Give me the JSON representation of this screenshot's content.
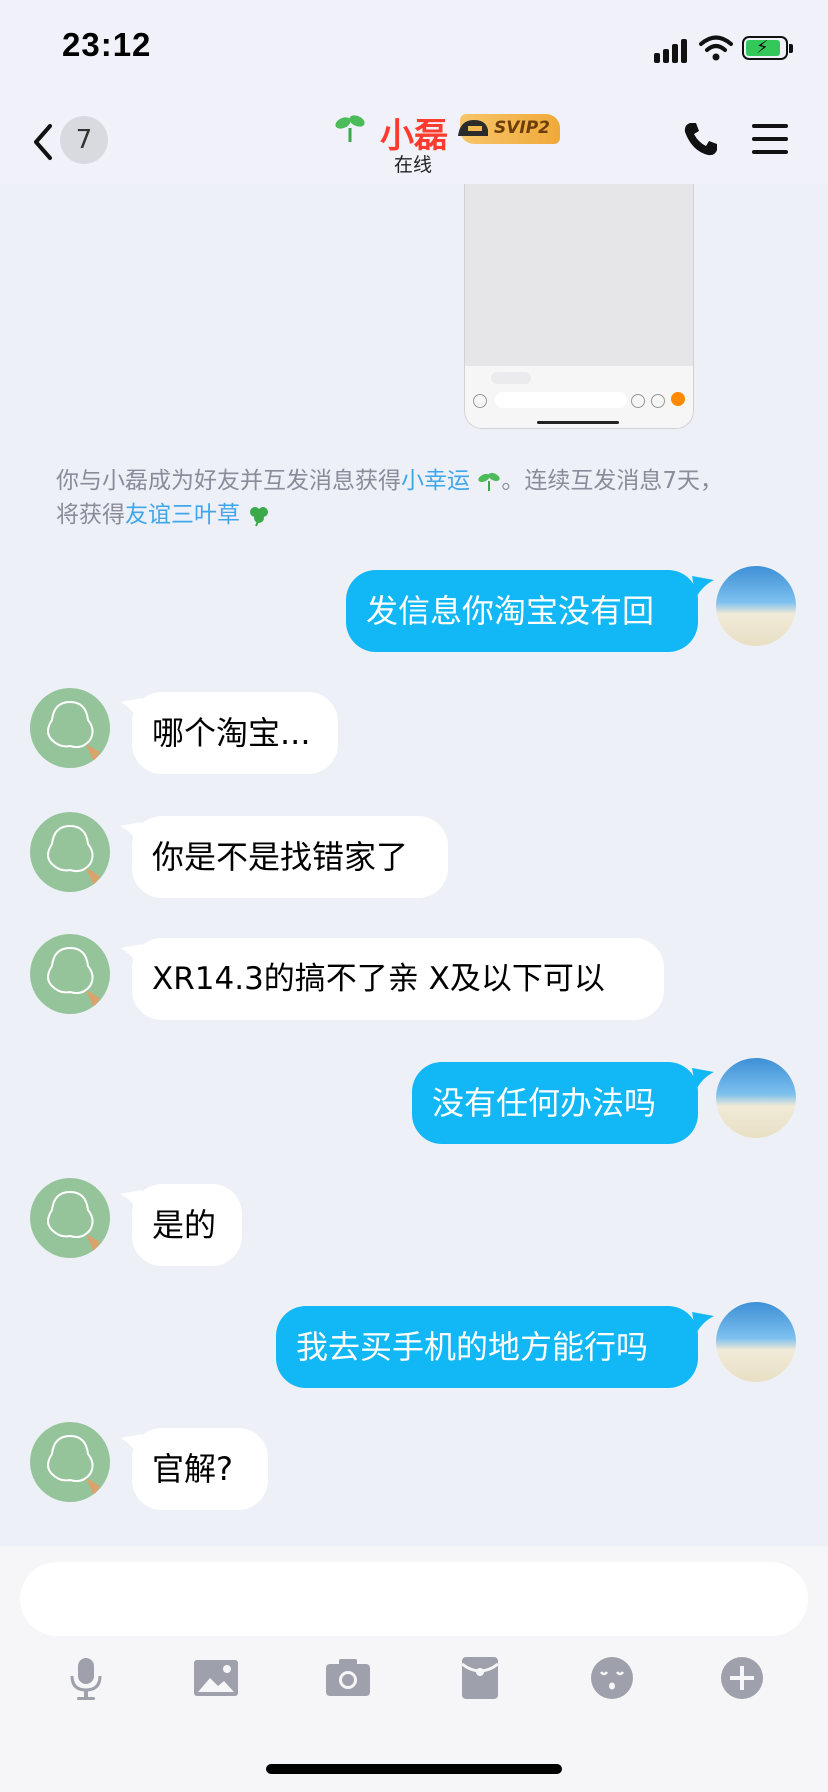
{
  "status_bar": {
    "time": "23:12"
  },
  "header": {
    "unread_count": "7",
    "contact_name": "小磊",
    "vip_badge": "SVIP2",
    "presence": "在线"
  },
  "system_message": {
    "line1_prefix": "你与小磊成为好友并互发消息获得",
    "line1_link": "小幸运",
    "line1_suffix": "。连续互发消息7天，",
    "line2_prefix": "将获得",
    "line2_link": "友谊三叶草"
  },
  "messages": [
    {
      "direction": "out",
      "text": "发信息你淘宝没有回"
    },
    {
      "direction": "in",
      "text": "哪个淘宝..."
    },
    {
      "direction": "in",
      "text": "你是不是找错家了"
    },
    {
      "direction": "in",
      "text": "XR14.3的搞不了亲 X及以下可以"
    },
    {
      "direction": "out",
      "text": "没有任何办法吗"
    },
    {
      "direction": "in",
      "text": "是的"
    },
    {
      "direction": "out",
      "text": "我去买手机的地方能行吗"
    },
    {
      "direction": "in",
      "text": "官解?"
    }
  ],
  "toolbar": {
    "icons": [
      "microphone-icon",
      "image-icon",
      "camera-icon",
      "red-packet-icon",
      "emoji-icon",
      "plus-icon"
    ]
  },
  "colors": {
    "outgoing_bubble": "#12b7f5",
    "incoming_bubble": "#ffffff",
    "link": "#3fa6ea",
    "nickname": "#ff3b30",
    "background": "#eef0f8"
  }
}
